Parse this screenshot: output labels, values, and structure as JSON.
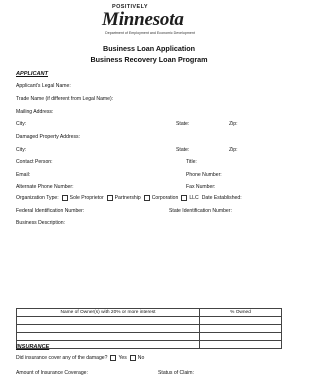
{
  "logo": {
    "top": "POSITIVELY",
    "main": "Minnesota",
    "sub": "Department of Employment and Economic Development"
  },
  "title": {
    "line1": "Business Loan Application",
    "line2": "Business Recovery Loan Program"
  },
  "applicant": {
    "heading": "APPLICANT",
    "legal_name": "Applicant's Legal Name:",
    "trade_name": "Trade Name (if different from Legal Name):",
    "mailing_address": "Mailing Address:",
    "city1": "City:",
    "state1": "State:",
    "zip1": "Zip:",
    "damaged_address": "Damaged Property Address:",
    "city2": "City:",
    "state2": "State:",
    "zip2": "Zip:",
    "contact_person": "Contact Person:",
    "title_label": "Title:",
    "email": "Email:",
    "phone": "Phone Number:",
    "alt_phone": "Alternate Phone Number:",
    "fax": "Fax Number:",
    "org_type": "Organization Type:",
    "org_options": [
      "Sole Proprietor",
      "Partnership",
      "Corporation",
      "LLC"
    ],
    "date_established": "Date Established:",
    "federal_id": "Federal Identification Number:",
    "state_id": "State Identification Number:",
    "business_description": "Business Description:"
  },
  "owners_table": {
    "headers": [
      "Name of Owner(s) with 20% or more interest",
      "% Owned"
    ],
    "rows": [
      [
        "",
        ""
      ],
      [
        "",
        ""
      ],
      [
        "",
        ""
      ],
      [
        "",
        ""
      ]
    ]
  },
  "insurance": {
    "heading": "INSURANCE",
    "question": "Did insurance cover any of the damage?",
    "yes": "Yes",
    "no": "No",
    "amount": "Amount of Insurance Coverage:",
    "status": "Status of Claim:"
  }
}
